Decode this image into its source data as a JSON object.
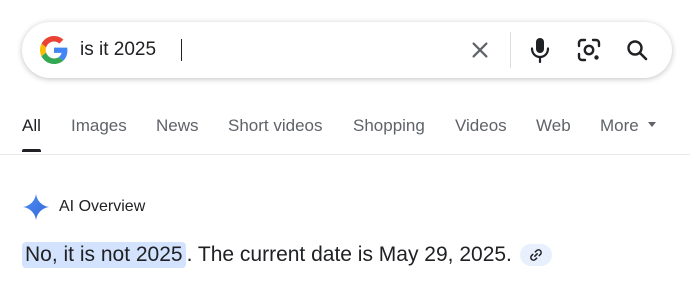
{
  "search": {
    "query": "is it 2025",
    "icons": {
      "logo": "google-g-icon",
      "clear": "close-icon",
      "voice": "microphone-icon",
      "lens": "camera-lens-icon",
      "search": "search-icon"
    }
  },
  "tabs": [
    {
      "label": "All",
      "active": true
    },
    {
      "label": "Images",
      "active": false
    },
    {
      "label": "News",
      "active": false
    },
    {
      "label": "Short videos",
      "active": false
    },
    {
      "label": "Shopping",
      "active": false
    },
    {
      "label": "Videos",
      "active": false
    },
    {
      "label": "Web",
      "active": false
    },
    {
      "label": "More",
      "active": false
    }
  ],
  "ai_overview": {
    "title": "AI Overview",
    "icon": "sparkle-icon",
    "answer_highlight": "No, it is not 2025",
    "answer_rest": ". The current date is May 29, 2025.",
    "link_icon": "link-icon"
  },
  "colors": {
    "highlight": "#d3e3fd",
    "sparkle": "#4285f4",
    "google_blue": "#4285f4",
    "google_red": "#ea4335",
    "google_yellow": "#fbbc05",
    "google_green": "#34a853"
  }
}
